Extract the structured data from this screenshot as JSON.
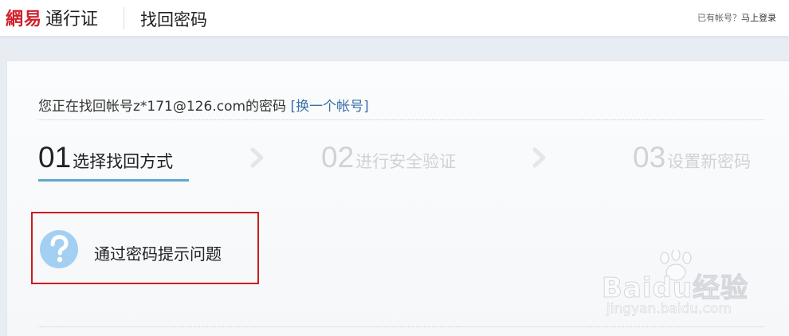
{
  "header": {
    "brand": "網易",
    "product": "通行证",
    "title": "找回密码",
    "has_account_text": "已有帐号？",
    "login_link": "马上登录"
  },
  "account": {
    "prefix": "您正在找回帐号",
    "email": "z*171@126.com",
    "suffix": "的密码",
    "switch_link": "[换一个帐号]"
  },
  "steps": [
    {
      "num": "01",
      "label": "选择找回方式",
      "active": true
    },
    {
      "num": "02",
      "label": "进行安全验证",
      "active": false
    },
    {
      "num": "03",
      "label": "设置新密码",
      "active": false
    }
  ],
  "options": [
    {
      "label": "通过密码提示问题",
      "icon": "question-icon"
    }
  ],
  "watermark": {
    "brand": "Baidu经验",
    "url": "jingyan.baidu.com"
  },
  "colors": {
    "brand_red": "#d0202b",
    "link_blue": "#3a6fa8",
    "step_active_underline": "#5fa7cf",
    "highlight_box": "#c81e1e",
    "question_icon": "#a3d0f2"
  }
}
